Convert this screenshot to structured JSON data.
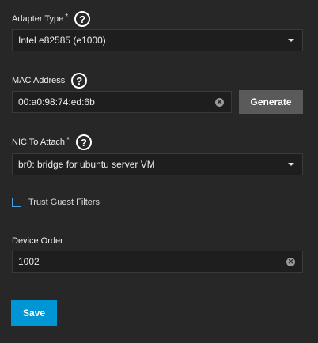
{
  "adapter_type": {
    "label": "Adapter Type",
    "required_mark": "*",
    "help": "?",
    "value": "Intel e82585 (e1000)"
  },
  "mac_address": {
    "label": "MAC Address",
    "help": "?",
    "value": "00:a0:98:74:ed:6b",
    "generate_label": "Generate"
  },
  "nic_to_attach": {
    "label": "NIC To Attach",
    "required_mark": "*",
    "help": "?",
    "value": "br0: bridge for ubuntu server VM"
  },
  "trust_guest_filters": {
    "label": "Trust Guest Filters",
    "checked": false
  },
  "device_order": {
    "label": "Device Order",
    "value": "1002"
  },
  "actions": {
    "save_label": "Save"
  },
  "icons": {
    "help": "help-circle-icon",
    "dropdown": "caret-down-icon",
    "clear": "clear-circle-icon"
  },
  "colors": {
    "background": "#272727",
    "field_bg": "#1e1e1e",
    "primary": "#0095d5",
    "secondary_button": "#5a5a5a",
    "checkbox_border": "#4aa3df"
  }
}
